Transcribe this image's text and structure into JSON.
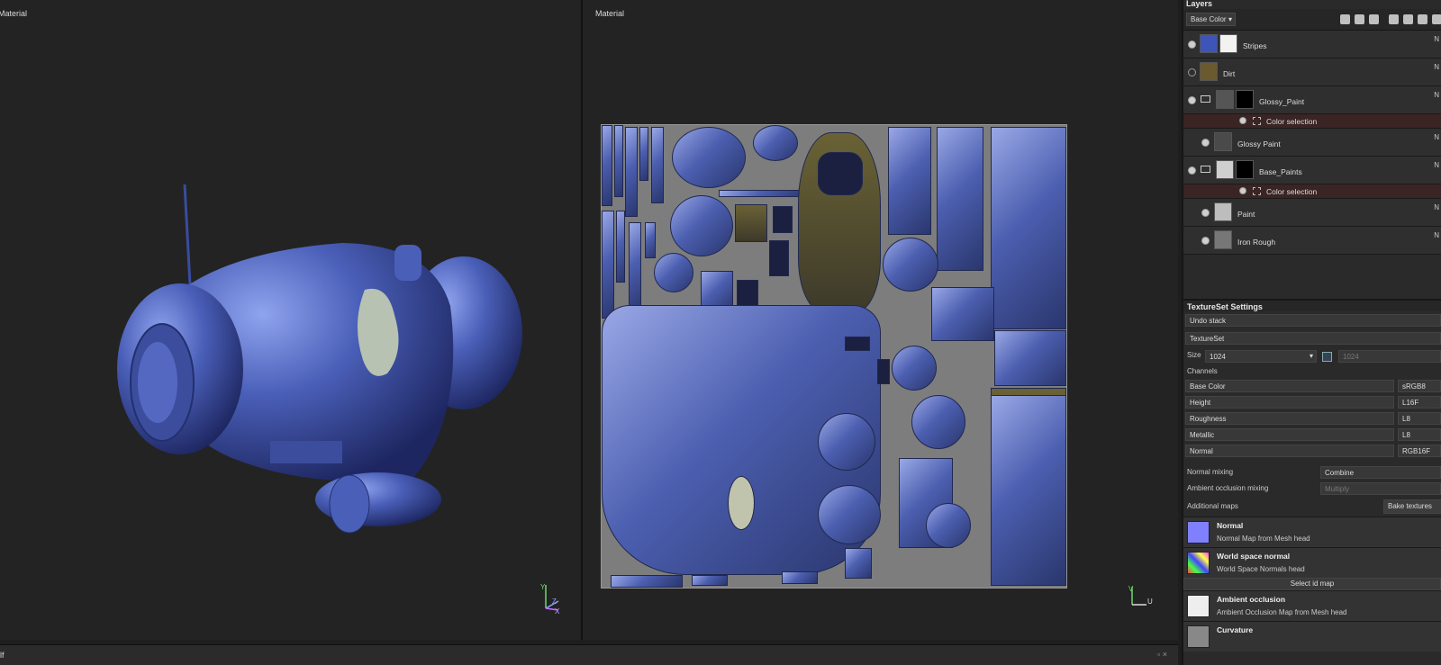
{
  "viewports": {
    "left_title": "Material",
    "right_title": "Material"
  },
  "axes": {
    "left": [
      "Y",
      "Z",
      "X"
    ],
    "right": [
      "V",
      "U"
    ]
  },
  "bottom": {
    "label": "lf",
    "controls": "▫ ×"
  },
  "layers_panel": {
    "title": "Layers",
    "channel_dropdown": "Base Color",
    "items": [
      {
        "name": "Stripes",
        "visible": true,
        "mark": "N"
      },
      {
        "name": "Dirt",
        "visible": false,
        "mark": "N"
      },
      {
        "name": "Glossy_Paint",
        "visible": true,
        "mark": "N"
      },
      {
        "name": "Color selection",
        "sub": true
      },
      {
        "name": "Glossy Paint",
        "visible": true,
        "mark": "N"
      },
      {
        "name": "Base_Paints",
        "visible": true,
        "mark": "N"
      },
      {
        "name": "Color selection",
        "sub": true
      },
      {
        "name": "Paint",
        "visible": true,
        "mark": "N"
      },
      {
        "name": "Iron Rough",
        "visible": true,
        "mark": "N"
      }
    ]
  },
  "textureset": {
    "title": "TextureSet Settings",
    "undo_stack": "Undo stack",
    "textureset_name": "TextureSet",
    "size_label": "Size",
    "size_value": "1024",
    "size_value2": "1024",
    "channels_label": "Channels",
    "channels": [
      {
        "name": "Base Color",
        "format": "sRGB8"
      },
      {
        "name": "Height",
        "format": "L16F"
      },
      {
        "name": "Roughness",
        "format": "L8"
      },
      {
        "name": "Metallic",
        "format": "L8"
      },
      {
        "name": "Normal",
        "format": "RGB16F"
      }
    ],
    "normal_mixing_label": "Normal mixing",
    "normal_mixing_value": "Combine",
    "ao_mixing_label": "Ambient occlusion mixing",
    "ao_mixing_value": "Multiply",
    "additional_maps_label": "Additional maps",
    "bake_button": "Bake textures",
    "select_id_map": "Select id map",
    "maps": [
      {
        "name": "Normal",
        "desc": "Normal Map from Mesh head",
        "thumb": "normal"
      },
      {
        "name": "World space normal",
        "desc": "World Space Normals head",
        "thumb": "world"
      },
      {
        "name": "Ambient occlusion",
        "desc": "Ambient Occlusion Map from Mesh head",
        "thumb": "ao"
      },
      {
        "name": "Curvature",
        "desc": "",
        "thumb": "curv"
      }
    ]
  },
  "colors": {
    "accent_blue": "#4a5fb8",
    "background": "#232323",
    "panel": "#2a2a2a",
    "selection_red": "#3a2424"
  }
}
